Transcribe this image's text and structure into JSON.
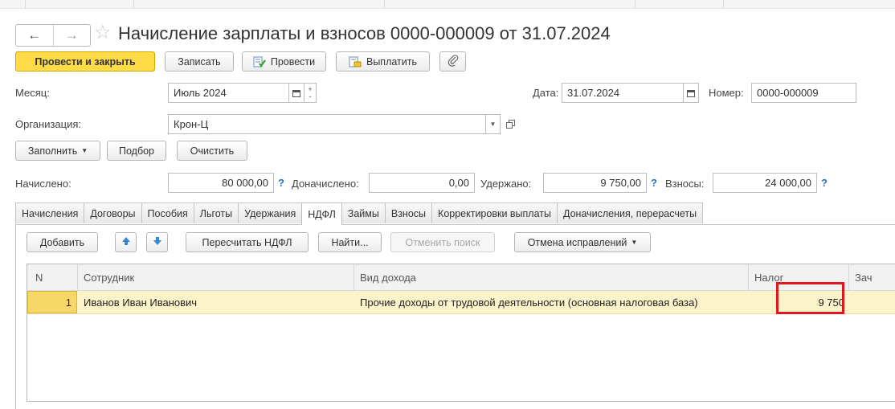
{
  "nav": {
    "back": "←",
    "forward": "→",
    "star": "☆"
  },
  "title": "Начисление зарплаты и взносов 0000-000009 от 31.07.2024",
  "toolbar": {
    "post_close": "Провести и закрыть",
    "write": "Записать",
    "post": "Провести",
    "pay": "Выплатить"
  },
  "form": {
    "month_label": "Месяц:",
    "month_value": "Июль 2024",
    "date_label": "Дата:",
    "date_value": "31.07.2024",
    "number_label": "Номер:",
    "number_value": "0000-000009",
    "org_label": "Организация:",
    "org_value": "Крон-Ц"
  },
  "actions": {
    "fill": "Заполнить",
    "pick": "Подбор",
    "clear": "Очистить"
  },
  "totals": {
    "accrued_label": "Начислено:",
    "accrued_value": "80 000,00",
    "extra_label": "Доначислено:",
    "extra_value": "0,00",
    "withheld_label": "Удержано:",
    "withheld_value": "9 750,00",
    "contrib_label": "Взносы:",
    "contrib_value": "24 000,00",
    "help": "?"
  },
  "tabs": [
    "Начисления",
    "Договоры",
    "Пособия",
    "Льготы",
    "Удержания",
    "НДФЛ",
    "Займы",
    "Взносы",
    "Корректировки выплаты",
    "Доначисления, перерасчеты"
  ],
  "active_tab": "НДФЛ",
  "ndfl_toolbar": {
    "add": "Добавить",
    "recalc": "Пересчитать НДФЛ",
    "find": "Найти...",
    "cancel_search": "Отменить поиск",
    "cancel_fix": "Отмена исправлений"
  },
  "table": {
    "columns": [
      "N",
      "Сотрудник",
      "Вид дохода",
      "Налог",
      "Зач"
    ],
    "rows": [
      {
        "n": "1",
        "employee": "Иванов Иван Иванович",
        "income": "Прочие доходы от трудовой деятельности (основная налоговая база)",
        "tax": "9 750"
      }
    ]
  },
  "colors": {
    "primary": "#fedb47",
    "selection": "#fbf3c9",
    "highlight": "#e0181d",
    "link": "#2a6fc9"
  }
}
